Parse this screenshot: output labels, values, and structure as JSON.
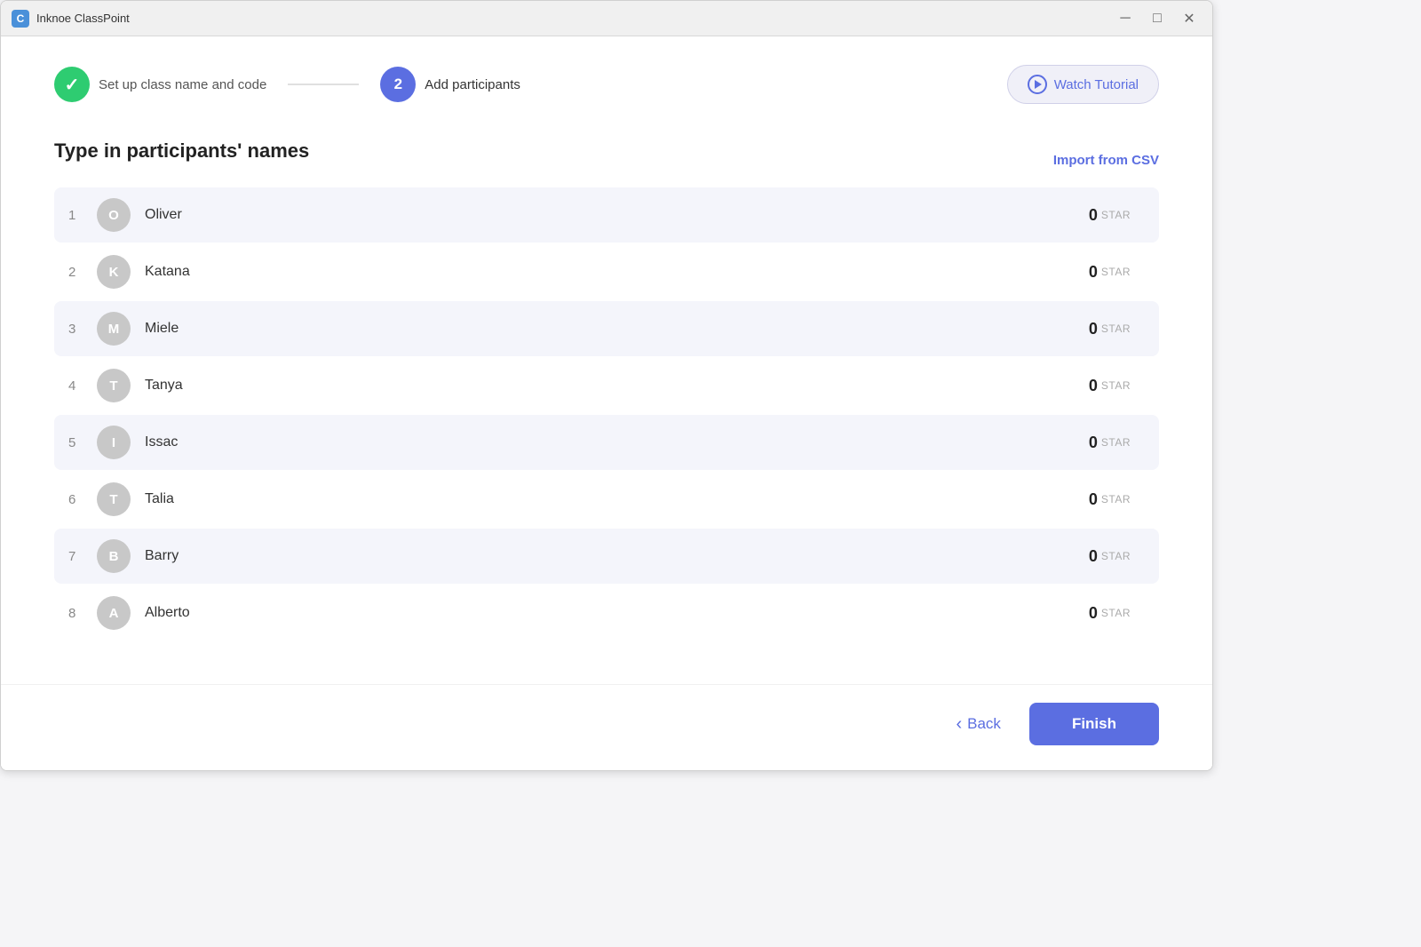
{
  "window": {
    "title": "Inknoe ClassPoint",
    "app_icon_letter": "C"
  },
  "controls": {
    "minimize": "─",
    "maximize": "□",
    "close": "✕"
  },
  "steps": [
    {
      "id": "step1",
      "number": "✓",
      "label": "Set up class name and code",
      "status": "done"
    },
    {
      "id": "step2",
      "number": "2",
      "label": "Add participants",
      "status": "active"
    }
  ],
  "tutorial": {
    "label": "Watch Tutorial"
  },
  "section": {
    "title": "Type in participants' names",
    "import_label": "Import from CSV"
  },
  "participants": [
    {
      "number": "1",
      "initial": "O",
      "name": "Oliver",
      "stars": "0"
    },
    {
      "number": "2",
      "initial": "K",
      "name": "Katana",
      "stars": "0"
    },
    {
      "number": "3",
      "initial": "M",
      "name": "Miele",
      "stars": "0"
    },
    {
      "number": "4",
      "initial": "T",
      "name": "Tanya",
      "stars": "0"
    },
    {
      "number": "5",
      "initial": "I",
      "name": "Issac",
      "stars": "0"
    },
    {
      "number": "6",
      "initial": "T",
      "name": "Talia",
      "stars": "0"
    },
    {
      "number": "7",
      "initial": "B",
      "name": "Barry",
      "stars": "0"
    },
    {
      "number": "8",
      "initial": "A",
      "name": "Alberto",
      "stars": "0"
    }
  ],
  "star_label": "STAR",
  "footer": {
    "back_label": "Back",
    "finish_label": "Finish"
  }
}
